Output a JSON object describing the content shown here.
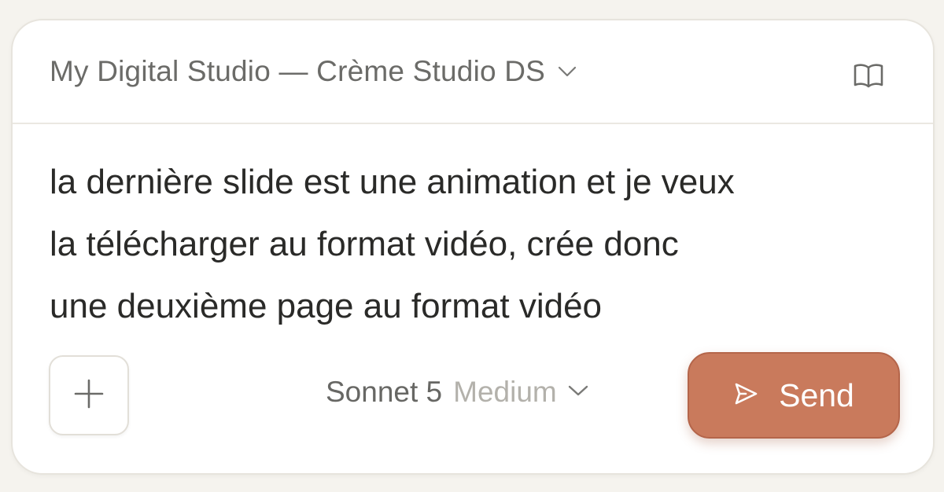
{
  "header": {
    "project_title": "My Digital Studio — Crème Studio DS",
    "dropdown_icon": "chevron-down-icon",
    "right_icon": "book-icon"
  },
  "composer": {
    "message": "la dernière slide est une animation et je veux\nla télécharger au format vidéo, crée donc\nune deuxième page au format vidéo"
  },
  "footer": {
    "add_icon": "plus-icon",
    "model_name": "Sonnet 5",
    "model_effort": "Medium",
    "model_dropdown_icon": "chevron-down-icon",
    "send_icon": "send-icon",
    "send_label": "Send"
  },
  "colors": {
    "background": "#f5f3ee",
    "card": "#ffffff",
    "accent": "#c97a5c",
    "text_primary": "#2a2a28",
    "text_muted": "#6b6b68",
    "text_faint": "#b3b1ab"
  }
}
